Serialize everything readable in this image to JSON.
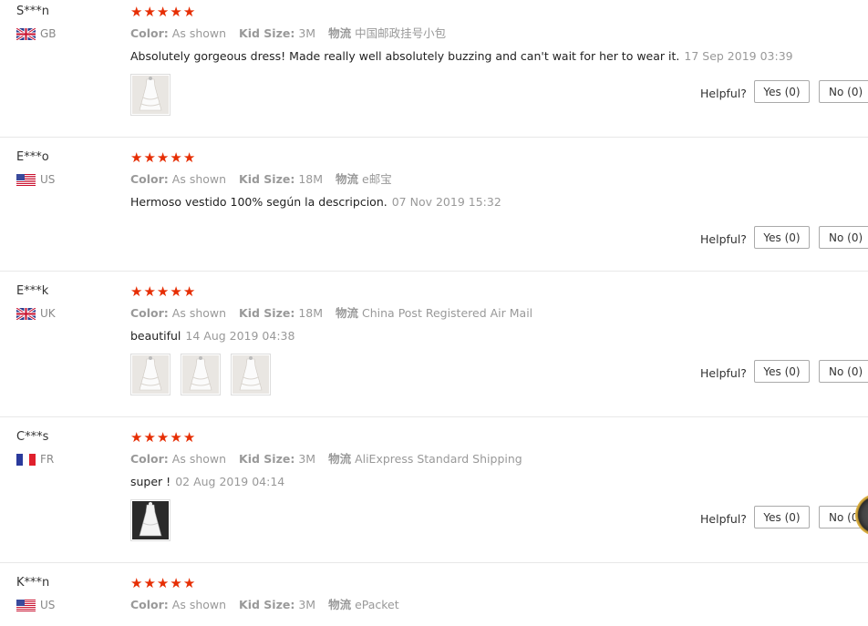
{
  "labels": {
    "color": "Color:",
    "kid_size": "Kid Size:",
    "shipping": "物流",
    "helpful": "Helpful?",
    "yes": "Yes (0)",
    "no": "No (0)"
  },
  "star_rating": 5,
  "colors": {
    "star": "#e62e04",
    "border": "#e8e8e8"
  },
  "reviews": [
    {
      "user": "S***n",
      "country": "GB",
      "flag": "uk-flag-icon",
      "color": "As shown",
      "kid_size": "3M",
      "shipping": "中国邮政挂号小包",
      "text": "Absolutely gorgeous dress! Made really well absolutely buzzing and can't wait for her to wear it.",
      "date": "17 Sep 2019 03:39",
      "photos": 1
    },
    {
      "user": "E***o",
      "country": "US",
      "flag": "us-flag-icon",
      "color": "As shown",
      "kid_size": "18M",
      "shipping": "e邮宝",
      "text": "Hermoso vestido 100% según la descripcion.",
      "date": "07 Nov 2019 15:32",
      "photos": 0
    },
    {
      "user": "E***k",
      "country": "UK",
      "flag": "uk-flag-icon",
      "color": "As shown",
      "kid_size": "18M",
      "shipping": "China Post Registered Air Mail",
      "text": "beautiful",
      "date": "14 Aug 2019 04:38",
      "photos": 3
    },
    {
      "user": "C***s",
      "country": "FR",
      "flag": "fr-flag-icon",
      "color": "As shown",
      "kid_size": "3M",
      "shipping": "AliExpress Standard Shipping",
      "text": "super !",
      "date": "02 Aug 2019 04:14",
      "photos": 1
    },
    {
      "user": "K***n",
      "country": "US",
      "flag": "us-flag-icon",
      "color": "As shown",
      "kid_size": "3M",
      "shipping": "ePacket",
      "text": "",
      "date": "",
      "photos": 0
    }
  ]
}
